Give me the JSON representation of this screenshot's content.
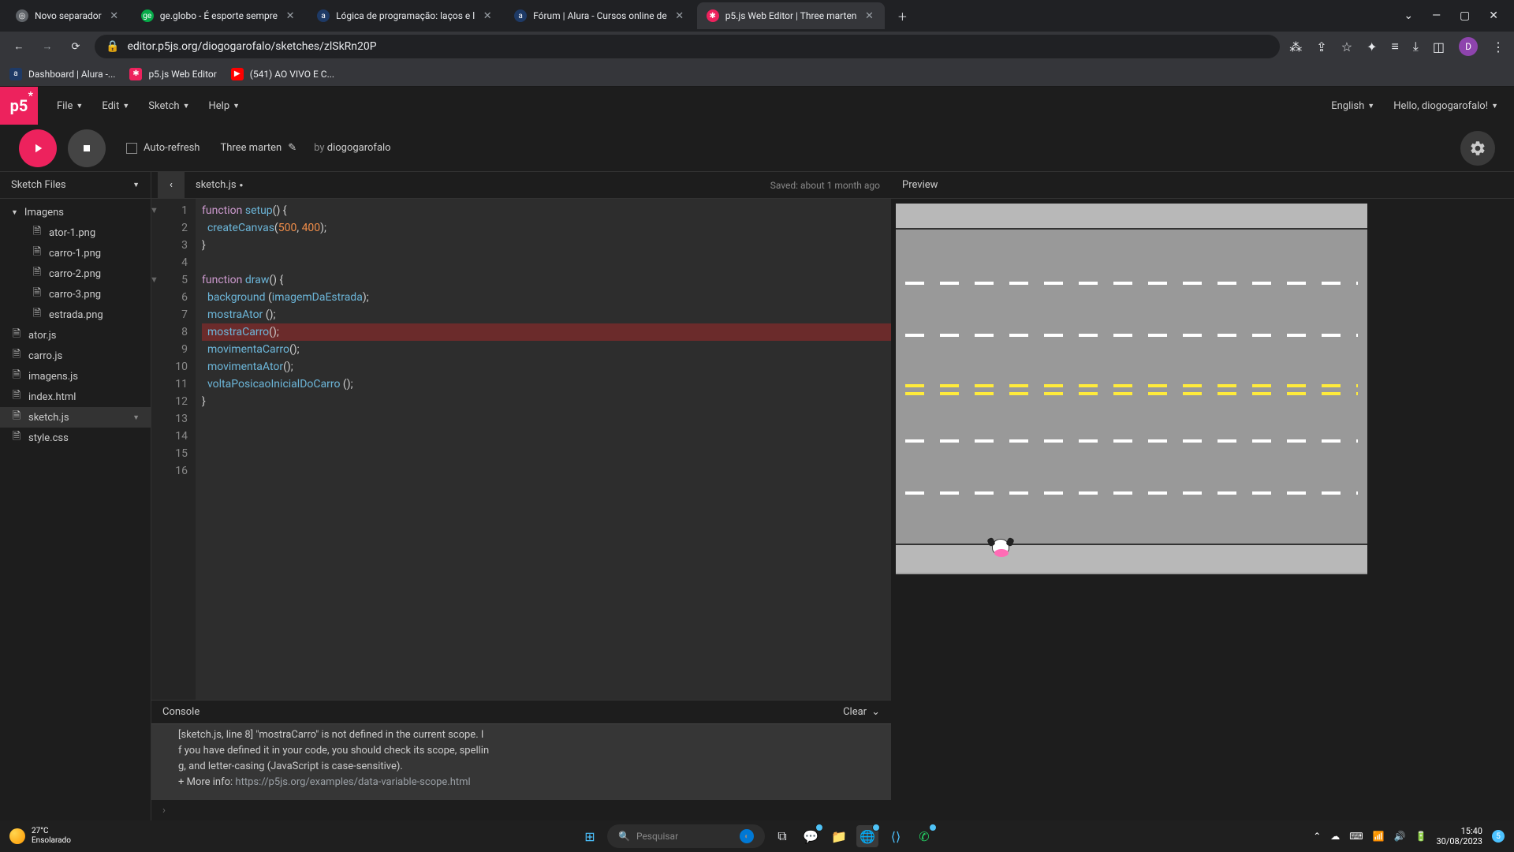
{
  "browser": {
    "tabs": [
      {
        "title": "Novo separador",
        "favicon_bg": "#5f6368",
        "favicon_text": "◎"
      },
      {
        "title": "ge.globo - É esporte sempre",
        "favicon_bg": "#06aa48",
        "favicon_text": "ge"
      },
      {
        "title": "Lógica de programação: laços e l",
        "favicon_bg": "#1e3a66",
        "favicon_text": "a"
      },
      {
        "title": "Fórum | Alura - Cursos online de",
        "favicon_bg": "#1e3a66",
        "favicon_text": "a"
      },
      {
        "title": "p5.js Web Editor | Three marten",
        "favicon_bg": "#ed225d",
        "favicon_text": "✱",
        "active": true
      }
    ],
    "url": "editor.p5js.org/diogogarofalo/sketches/zlSkRn20P",
    "profile_initial": "D",
    "bookmarks": [
      {
        "title": "Dashboard | Alura -...",
        "icon_bg": "#1e3a66",
        "icon_text": "a"
      },
      {
        "title": "p5.js Web Editor",
        "icon_bg": "#ed225d",
        "icon_text": "✱"
      },
      {
        "title": "(541) AO VIVO E C...",
        "icon_bg": "#ff0000",
        "icon_text": "▶"
      }
    ]
  },
  "p5": {
    "logo": "p5",
    "menu": {
      "file": "File",
      "edit": "Edit",
      "sketch": "Sketch",
      "help": "Help"
    },
    "language": "English",
    "greeting": "Hello, diogogarofalo!",
    "auto_refresh": "Auto-refresh",
    "sketch_name": "Three marten",
    "by": "by",
    "author": "diogogarofalo",
    "sidebar_header": "Sketch Files",
    "files": {
      "folder": "Imagens",
      "folder_children": [
        "ator-1.png",
        "carro-1.png",
        "carro-2.png",
        "carro-3.png",
        "estrada.png"
      ],
      "root": [
        "ator.js",
        "carro.js",
        "imagens.js",
        "index.html",
        "sketch.js",
        "style.css"
      ],
      "active": "sketch.js"
    },
    "tab_name": "sketch.js",
    "tab_dirty": "●",
    "saved": "Saved: about 1 month ago",
    "preview_label": "Preview",
    "console": {
      "label": "Console",
      "clear": "Clear",
      "msg_line1": "[sketch.js, line 8] \"mostraCarro\" is not defined in the current scope. I",
      "msg_line2": "f you have defined it in your code, you should check its scope, spellin",
      "msg_line3": "g, and letter-casing (JavaScript is case-sensitive).",
      "msg_blank": "",
      "msg_line4_prefix": "+ More info: ",
      "msg_line4_link": "https://p5js.org/examples/data-variable-scope.html",
      "prompt": "›"
    }
  },
  "code": {
    "lines": [
      {
        "n": 1,
        "fold": true,
        "html": "<span class='kw'>function</span> <span class='fn'>setup</span><span class='paren'>() {</span>"
      },
      {
        "n": 2,
        "html": "  <span class='fn'>createCanvas</span><span class='paren'>(</span><span class='num'>500</span><span class='paren'>, </span><span class='num'>400</span><span class='paren'>);</span>"
      },
      {
        "n": 3,
        "html": "<span class='paren'>}</span>"
      },
      {
        "n": 4,
        "html": ""
      },
      {
        "n": 5,
        "fold": true,
        "html": "<span class='kw'>function</span> <span class='fn'>draw</span><span class='paren'>() {</span>"
      },
      {
        "n": 6,
        "html": "  <span class='fn'>background</span> <span class='paren'>(</span><span class='var'>imagemDaEstrada</span><span class='paren'>);</span>"
      },
      {
        "n": 7,
        "html": "  <span class='var'>mostraAtor</span> <span class='paren'>();</span>"
      },
      {
        "n": 8,
        "error": true,
        "html": "  <span class='var'>mostraCarro</span><span class='paren'>();</span>"
      },
      {
        "n": 9,
        "html": "  <span class='var'>movimentaCarro</span><span class='paren'>();</span>"
      },
      {
        "n": 10,
        "html": "  <span class='var'>movimentaAtor</span><span class='paren'>();</span>"
      },
      {
        "n": 11,
        "html": "  <span class='var'>voltaPosicaoInicialDoCarro</span> <span class='paren'>();</span>"
      },
      {
        "n": 12,
        "html": "<span class='paren'>}</span>"
      },
      {
        "n": 13,
        "html": ""
      },
      {
        "n": 14,
        "html": ""
      },
      {
        "n": 15,
        "html": ""
      },
      {
        "n": 16,
        "html": ""
      }
    ]
  },
  "taskbar": {
    "temp": "27°C",
    "weather": "Ensolarado",
    "search_placeholder": "Pesquisar",
    "time": "15:40",
    "date": "30/08/2023"
  }
}
